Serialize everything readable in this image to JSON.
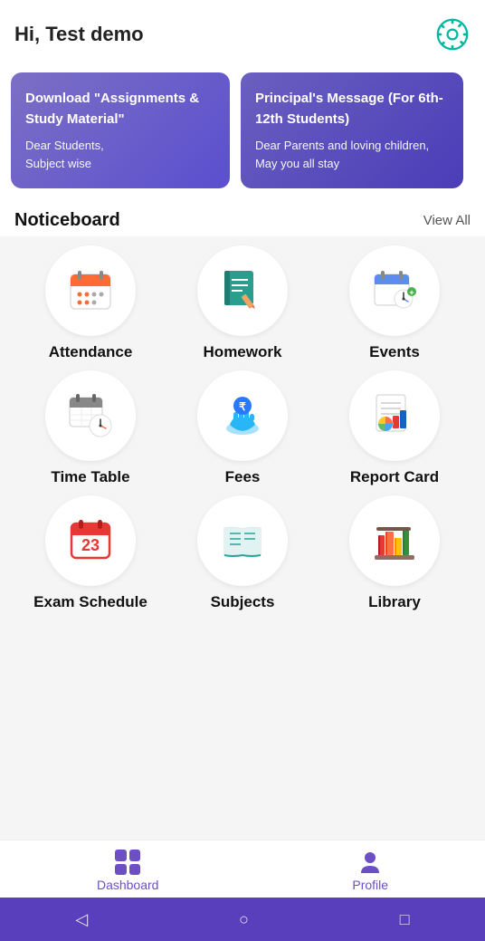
{
  "header": {
    "greeting": "Hi, Test demo",
    "gear_icon": "gear-icon"
  },
  "banners": [
    {
      "title": "Download \"Assignments & Study Material\"",
      "body": "Dear Students,",
      "sub": "Subject wise"
    },
    {
      "title": "Principal's Message (For 6th-12th Students)",
      "body": "Dear Parents and loving children,",
      "sub": "May you all stay"
    }
  ],
  "noticeboard": {
    "label": "Noticeboard",
    "view_all": "View All"
  },
  "grid": {
    "rows": [
      [
        {
          "label": "Attendance",
          "icon": "attendance"
        },
        {
          "label": "Homework",
          "icon": "homework"
        },
        {
          "label": "Events",
          "icon": "events"
        }
      ],
      [
        {
          "label": "Time Table",
          "icon": "timetable"
        },
        {
          "label": "Fees",
          "icon": "fees"
        },
        {
          "label": "Report Card",
          "icon": "reportcard"
        }
      ],
      [
        {
          "label": "Exam Schedule",
          "icon": "examschedule"
        },
        {
          "label": "Subjects",
          "icon": "subjects"
        },
        {
          "label": "Library",
          "icon": "library"
        }
      ]
    ]
  },
  "bottom_nav": {
    "items": [
      {
        "label": "Dashboard",
        "icon": "dashboard-icon",
        "active": true
      },
      {
        "label": "Profile",
        "icon": "profile-icon",
        "active": false
      }
    ]
  },
  "system_nav": {
    "back": "◁",
    "home": "○",
    "recent": "□"
  }
}
